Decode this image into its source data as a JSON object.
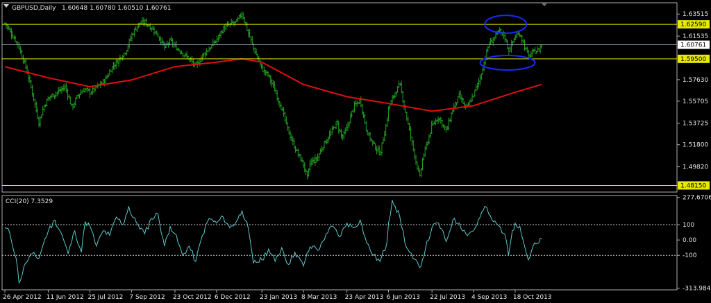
{
  "header": {
    "symbol": "GBPUSD,Daily",
    "ohlc": "1.60648 1.60780 1.60510 1.60761"
  },
  "colors": {
    "background": "#000000",
    "candles": "#22a022",
    "ma": "#e01010",
    "level": "#e8e800",
    "axis": "#b0b0b0",
    "grid": "#c8c8c8",
    "cci": "#5fc8cc",
    "ellipse": "#1a2aff",
    "current": "#8a9aaa"
  },
  "chart_data": [
    {
      "type": "candlestick",
      "title": "GBPUSD,Daily",
      "ylim": [
        1.4768,
        1.644
      ],
      "x_ticks": [
        "26 Apr 2012",
        "11 Jun 2012",
        "25 Jul 2012",
        "7 Sep 2012",
        "23 Oct 2012",
        "6 Dec 2012",
        "23 Jan 2013",
        "8 Mar 2013",
        "23 Apr 2013",
        "6 Jun 2013",
        "22 Jul 2013",
        "4 Sep 2013",
        "18 Oct 2013"
      ],
      "y_ticks": [
        "1.63515",
        "1.61535",
        "1.57630",
        "1.55705",
        "1.53725",
        "1.51800",
        "1.49820"
      ],
      "levels": [
        {
          "value": 1.6259,
          "label": "1.62590"
        },
        {
          "value": 1.595,
          "label": "1.59500"
        },
        {
          "value": 1.4815,
          "label": "1.48150"
        }
      ],
      "current_price": {
        "value": 1.60761,
        "label": "1.60761"
      },
      "close_path": [
        [
          "26 Apr 2012",
          1.627
        ],
        [
          "01 May 2012",
          1.62
        ],
        [
          "10 May 2012",
          1.608
        ],
        [
          "18 May 2012",
          1.588
        ],
        [
          "25 May 2012",
          1.565
        ],
        [
          "01 Jun 2012",
          1.538
        ],
        [
          "06 Jun 2012",
          1.552
        ],
        [
          "11 Jun 2012",
          1.56
        ],
        [
          "20 Jun 2012",
          1.565
        ],
        [
          "29 Jun 2012",
          1.57
        ],
        [
          "06 Jul 2012",
          1.551
        ],
        [
          "12 Jul 2012",
          1.562
        ],
        [
          "19 Jul 2012",
          1.568
        ],
        [
          "25 Jul 2012",
          1.565
        ],
        [
          "03 Aug 2012",
          1.571
        ],
        [
          "10 Aug 2012",
          1.576
        ],
        [
          "17 Aug 2012",
          1.587
        ],
        [
          "25 Aug 2012",
          1.595
        ],
        [
          "01 Sep 2012",
          1.602
        ],
        [
          "07 Sep 2012",
          1.616
        ],
        [
          "14 Sep 2012",
          1.626
        ],
        [
          "21 Sep 2012",
          1.628
        ],
        [
          "28 Sep 2012",
          1.623
        ],
        [
          "05 Oct 2012",
          1.616
        ],
        [
          "12 Oct 2012",
          1.605
        ],
        [
          "18 Oct 2012",
          1.611
        ],
        [
          "23 Oct 2012",
          1.606
        ],
        [
          "31 Oct 2012",
          1.6
        ],
        [
          "07 Nov 2012",
          1.595
        ],
        [
          "14 Nov 2012",
          1.588
        ],
        [
          "21 Nov 2012",
          1.598
        ],
        [
          "28 Nov 2012",
          1.604
        ],
        [
          "06 Dec 2012",
          1.612
        ],
        [
          "13 Dec 2012",
          1.622
        ],
        [
          "20 Dec 2012",
          1.626
        ],
        [
          "27 Dec 2012",
          1.628
        ],
        [
          "02 Jan 2013",
          1.636
        ],
        [
          "07 Jan 2013",
          1.622
        ],
        [
          "14 Jan 2013",
          1.605
        ],
        [
          "23 Jan 2013",
          1.586
        ],
        [
          "30 Jan 2013",
          1.58
        ],
        [
          "06 Feb 2013",
          1.566
        ],
        [
          "13 Feb 2013",
          1.55
        ],
        [
          "20 Feb 2013",
          1.53
        ],
        [
          "27 Feb 2013",
          1.515
        ],
        [
          "08 Mar 2013",
          1.5
        ],
        [
          "12 Mar 2013",
          1.488
        ],
        [
          "15 Mar 2013",
          1.502
        ],
        [
          "22 Mar 2013",
          1.505
        ],
        [
          "29 Mar 2013",
          1.518
        ],
        [
          "05 Apr 2013",
          1.527
        ],
        [
          "12 Apr 2013",
          1.538
        ],
        [
          "18 Apr 2013",
          1.524
        ],
        [
          "23 Apr 2013",
          1.533
        ],
        [
          "30 Apr 2013",
          1.552
        ],
        [
          "07 May 2013",
          1.558
        ],
        [
          "14 May 2013",
          1.53
        ],
        [
          "21 May 2013",
          1.518
        ],
        [
          "28 May 2013",
          1.51
        ],
        [
          "04 Jun 2013",
          1.538
        ],
        [
          "06 Jun 2013",
          1.551
        ],
        [
          "13 Jun 2013",
          1.565
        ],
        [
          "18 Jun 2013",
          1.572
        ],
        [
          "25 Jun 2013",
          1.543
        ],
        [
          "02 Jul 2013",
          1.515
        ],
        [
          "09 Jul 2013",
          1.488
        ],
        [
          "12 Jul 2013",
          1.505
        ],
        [
          "22 Jul 2013",
          1.535
        ],
        [
          "29 Jul 2013",
          1.543
        ],
        [
          "06 Aug 2013",
          1.53
        ],
        [
          "13 Aug 2013",
          1.55
        ],
        [
          "20 Aug 2013",
          1.562
        ],
        [
          "27 Aug 2013",
          1.55
        ],
        [
          "04 Sep 2013",
          1.563
        ],
        [
          "11 Sep 2013",
          1.578
        ],
        [
          "16 Sep 2013",
          1.595
        ],
        [
          "20 Sep 2013",
          1.608
        ],
        [
          "25 Sep 2013",
          1.613
        ],
        [
          "01 Oct 2013",
          1.62
        ],
        [
          "07 Oct 2013",
          1.615
        ],
        [
          "11 Oct 2013",
          1.602
        ],
        [
          "18 Oct 2013",
          1.615
        ],
        [
          "23 Oct 2013",
          1.618
        ],
        [
          "28 Oct 2013",
          1.606
        ],
        [
          "01 Nov 2013",
          1.597
        ],
        [
          "06 Nov 2013",
          1.601
        ],
        [
          "12 Nov 2013",
          1.603
        ],
        [
          "15 Nov 2013",
          1.6076
        ]
      ],
      "moving_average": {
        "points": [
          [
            "26 Apr 2012",
            1.588
          ],
          [
            "11 Jun 2012",
            1.578
          ],
          [
            "25 Jul 2012",
            1.57
          ],
          [
            "7 Sep 2012",
            1.576
          ],
          [
            "23 Oct 2012",
            1.588
          ],
          [
            "6 Dec 2012",
            1.592
          ],
          [
            "2 Jan 2013",
            1.595
          ],
          [
            "23 Jan 2013",
            1.592
          ],
          [
            "8 Mar 2013",
            1.572
          ],
          [
            "23 Apr 2013",
            1.561
          ],
          [
            "6 Jun 2013",
            1.555
          ],
          [
            "22 Jul 2013",
            1.548
          ],
          [
            "4 Sep 2013",
            1.553
          ],
          [
            "18 Oct 2013",
            1.565
          ],
          [
            "15 Nov 2013",
            1.572
          ]
        ]
      },
      "annotations": [
        {
          "shape": "ellipse",
          "start": "16 Sep 2013",
          "end": "30 Oct 2013",
          "y_range": [
            1.618,
            1.634
          ]
        },
        {
          "shape": "ellipse",
          "start": "11 Sep 2013",
          "end": "08 Nov 2013",
          "y_range": [
            1.585,
            1.598
          ]
        }
      ]
    },
    {
      "type": "line",
      "title": "CCI(20) 7.3529",
      "ylim": [
        -325,
        290
      ],
      "y_ticks": [
        "277.6706",
        "100",
        "0.00",
        "-100",
        "-313.9847"
      ],
      "reference_levels": [
        100,
        -100
      ],
      "series": [
        {
          "values": [
            [
              "26 Apr 2012",
              80
            ],
            [
              "01 May 2012",
              50
            ],
            [
              "08 May 2012",
              -120
            ],
            [
              "11 May 2012",
              -280
            ],
            [
              "18 May 2012",
              -150
            ],
            [
              "25 May 2012",
              -90
            ],
            [
              "01 Jun 2012",
              -120
            ],
            [
              "06 Jun 2012",
              -20
            ],
            [
              "11 Jun 2012",
              60
            ],
            [
              "18 Jun 2012",
              130
            ],
            [
              "25 Jun 2012",
              40
            ],
            [
              "02 Jul 2012",
              -90
            ],
            [
              "09 Jul 2012",
              60
            ],
            [
              "16 Jul 2012",
              -80
            ],
            [
              "20 Jul 2012",
              120
            ],
            [
              "25 Jul 2012",
              90
            ],
            [
              "01 Aug 2012",
              -40
            ],
            [
              "08 Aug 2012",
              60
            ],
            [
              "15 Aug 2012",
              30
            ],
            [
              "22 Aug 2012",
              150
            ],
            [
              "29 Aug 2012",
              100
            ],
            [
              "04 Sep 2012",
              220
            ],
            [
              "07 Sep 2012",
              160
            ],
            [
              "14 Sep 2012",
              100
            ],
            [
              "21 Sep 2012",
              40
            ],
            [
              "28 Sep 2012",
              140
            ],
            [
              "05 Oct 2012",
              170
            ],
            [
              "12 Oct 2012",
              -40
            ],
            [
              "18 Oct 2012",
              90
            ],
            [
              "23 Oct 2012",
              40
            ],
            [
              "31 Oct 2012",
              -100
            ],
            [
              "07 Nov 2012",
              -40
            ],
            [
              "14 Nov 2012",
              -140
            ],
            [
              "21 Nov 2012",
              30
            ],
            [
              "28 Nov 2012",
              140
            ],
            [
              "06 Dec 2012",
              110
            ],
            [
              "13 Dec 2012",
              150
            ],
            [
              "20 Dec 2012",
              80
            ],
            [
              "27 Dec 2012",
              120
            ],
            [
              "02 Jan 2013",
              190
            ],
            [
              "07 Jan 2013",
              120
            ],
            [
              "14 Jan 2013",
              -150
            ],
            [
              "23 Jan 2013",
              -130
            ],
            [
              "30 Jan 2013",
              -60
            ],
            [
              "06 Feb 2013",
              -140
            ],
            [
              "13 Feb 2013",
              -50
            ],
            [
              "20 Feb 2013",
              -160
            ],
            [
              "27 Feb 2013",
              -80
            ],
            [
              "08 Mar 2013",
              -170
            ],
            [
              "12 Mar 2013",
              -80
            ],
            [
              "18 Mar 2013",
              -40
            ],
            [
              "25 Mar 2013",
              -60
            ],
            [
              "01 Apr 2013",
              40
            ],
            [
              "08 Apr 2013",
              90
            ],
            [
              "15 Apr 2013",
              20
            ],
            [
              "23 Apr 2013",
              110
            ],
            [
              "30 Apr 2013",
              80
            ],
            [
              "07 May 2013",
              130
            ],
            [
              "14 May 2013",
              -20
            ],
            [
              "21 May 2013",
              -100
            ],
            [
              "28 May 2013",
              -140
            ],
            [
              "04 Jun 2013",
              -30
            ],
            [
              "06 Jun 2013",
              110
            ],
            [
              "10 Jun 2013",
              260
            ],
            [
              "13 Jun 2013",
              220
            ],
            [
              "18 Jun 2013",
              150
            ],
            [
              "25 Jun 2013",
              -50
            ],
            [
              "02 Jul 2013",
              -120
            ],
            [
              "09 Jul 2013",
              -180
            ],
            [
              "15 Jul 2013",
              -60
            ],
            [
              "22 Jul 2013",
              80
            ],
            [
              "29 Jul 2013",
              110
            ],
            [
              "06 Aug 2013",
              -10
            ],
            [
              "13 Aug 2013",
              130
            ],
            [
              "20 Aug 2013",
              110
            ],
            [
              "27 Aug 2013",
              40
            ],
            [
              "04 Sep 2013",
              60
            ],
            [
              "11 Sep 2013",
              150
            ],
            [
              "16 Sep 2013",
              220
            ],
            [
              "20 Sep 2013",
              170
            ],
            [
              "25 Sep 2013",
              120
            ],
            [
              "01 Oct 2013",
              90
            ],
            [
              "07 Oct 2013",
              40
            ],
            [
              "11 Oct 2013",
              -100
            ],
            [
              "15 Oct 2013",
              60
            ],
            [
              "18 Oct 2013",
              110
            ],
            [
              "23 Oct 2013",
              90
            ],
            [
              "28 Oct 2013",
              -40
            ],
            [
              "01 Nov 2013",
              -130
            ],
            [
              "06 Nov 2013",
              -40
            ],
            [
              "12 Nov 2013",
              -20
            ],
            [
              "15 Nov 2013",
              7.35
            ]
          ]
        }
      ]
    }
  ]
}
